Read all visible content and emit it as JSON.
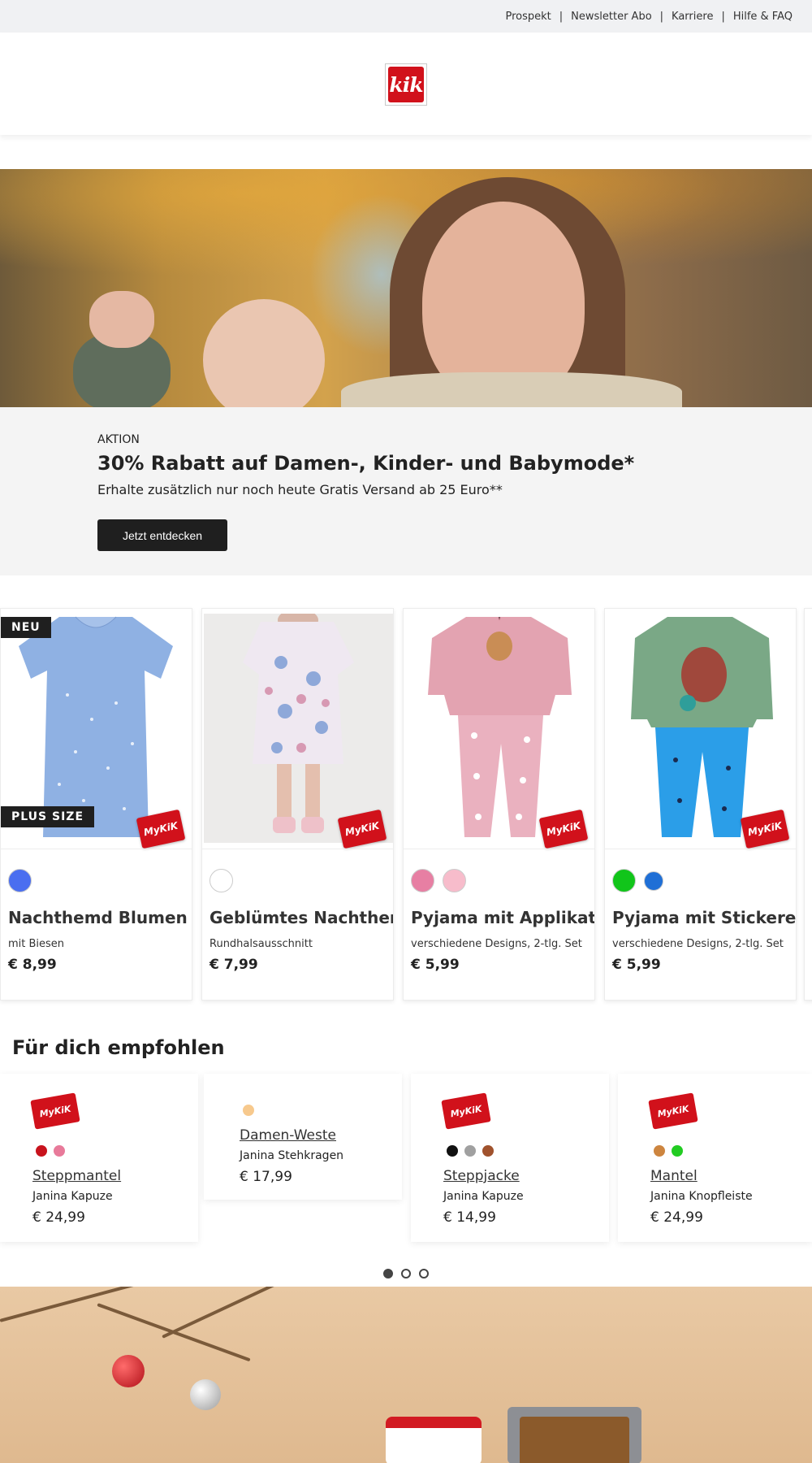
{
  "top_nav": {
    "items": [
      "Prospekt",
      "Newsletter Abo",
      "Karriere",
      "Hilfe & FAQ"
    ],
    "separator": "|"
  },
  "logo": {
    "text": "kik",
    "color": "#d1111b"
  },
  "promo": {
    "eyebrow": "AKTION",
    "headline": "30% Rabatt auf Damen-, Kinder- und Babymode*",
    "subline": "Erhalte zusätzlich nur noch heute Gratis Versand ab 25 Euro**",
    "cta_label": "Jetzt entdecken"
  },
  "products": [
    {
      "name": "Nachthemd Blumen",
      "desc": "mit Biesen",
      "price": "€ 8,99",
      "badges": [
        "NEU",
        "PLUS SIZE"
      ],
      "swatches": [
        "#4a6ef0"
      ],
      "mykik": "MyKiK"
    },
    {
      "name": "Geblümtes Nachthemd",
      "desc": "Rundhalsausschnitt",
      "price": "€ 7,99",
      "badges": [],
      "swatches": [
        "#ffffff"
      ],
      "mykik": "MyKiK"
    },
    {
      "name": "Pyjama mit Applikation",
      "desc": "verschiedene Designs, 2-tlg. Set",
      "price": "€ 5,99",
      "badges": [],
      "swatches": [
        "#e77fa3",
        "#f7bccb"
      ],
      "mykik": "MyKiK"
    },
    {
      "name": "Pyjama mit Stickerei",
      "desc": "verschiedene Designs, 2-tlg. Set",
      "price": "€ 5,99",
      "badges": [],
      "swatches": [
        "#11c51a",
        "#1f6fd6"
      ],
      "mykik": "MyKiK"
    }
  ],
  "recommended": {
    "title": "Für dich empfohlen",
    "items": [
      {
        "name": "Steppmantel",
        "desc": "Janina Kapuze",
        "price": "€ 24,99",
        "colors": [
          "#c8131d",
          "#e87a9a"
        ],
        "mykik": "MyKiK"
      },
      {
        "name": "Damen-Weste",
        "desc": "Janina Stehkragen",
        "price": "€ 17,99",
        "colors": [
          "#f7c98d"
        ],
        "mykik": ""
      },
      {
        "name": "Steppjacke",
        "desc": "Janina Kapuze",
        "price": "€ 14,99",
        "colors": [
          "#111111",
          "#a0a0a0",
          "#a0522d"
        ],
        "mykik": "MyKiK"
      },
      {
        "name": "Mantel",
        "desc": "Janina Knopfleiste",
        "price": "€ 24,99",
        "colors": [
          "#cd853f",
          "#22cc22"
        ],
        "mykik": "MyKiK"
      }
    ],
    "pager": {
      "pages": 3,
      "active": 1
    }
  }
}
